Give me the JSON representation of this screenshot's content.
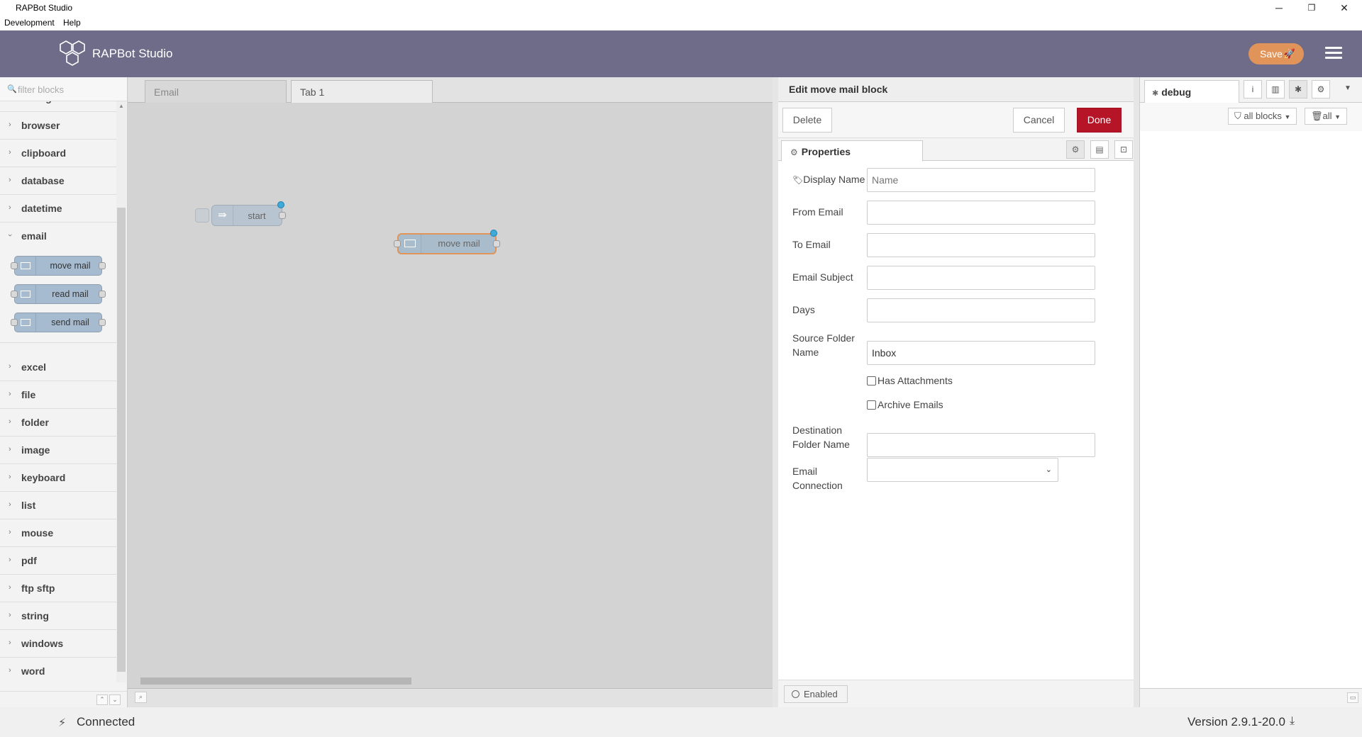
{
  "window": {
    "title": "RAPBot Studio",
    "minimize": "─",
    "restore": "❐",
    "close": "✕"
  },
  "menu": {
    "items": [
      "Development",
      "Help"
    ]
  },
  "header": {
    "app_name": "RAPBot Studio",
    "save_label": "Save",
    "accent": "#e0945a",
    "bg": "#6e6c88"
  },
  "palette": {
    "search_placeholder": "filter blocks",
    "categories_top": [
      "storage",
      "browser",
      "clipboard",
      "database",
      "datetime",
      "email"
    ],
    "email_nodes": [
      "move mail",
      "read mail",
      "send mail"
    ],
    "categories_bottom": [
      "excel",
      "file",
      "folder",
      "image",
      "keyboard",
      "list",
      "mouse",
      "pdf",
      "ftp sftp",
      "string",
      "windows",
      "word"
    ]
  },
  "workspace": {
    "tabs": [
      "Email",
      "Tab 1"
    ],
    "active_tab": "Tab 1",
    "nodes": {
      "start": "start",
      "move_mail": "move mail"
    }
  },
  "editor": {
    "title": "Edit move mail block",
    "delete_label": "Delete",
    "cancel_label": "Cancel",
    "done_label": "Done",
    "properties_tab": "Properties",
    "fields": {
      "display_name": {
        "label": "Display Name",
        "placeholder": "Name",
        "value": ""
      },
      "from_email": {
        "label": "From Email",
        "value": ""
      },
      "to_email": {
        "label": "To Email",
        "value": ""
      },
      "email_subject": {
        "label": "Email Subject",
        "value": ""
      },
      "days": {
        "label": "Days",
        "value": ""
      },
      "source_folder": {
        "label_line1": "Source Folder",
        "label_line2": "Name",
        "value": "Inbox"
      },
      "has_attachments": {
        "label": "Has Attachments",
        "checked": false
      },
      "archive_emails": {
        "label": "Archive Emails",
        "checked": false
      },
      "destination_folder": {
        "label_line1": "Destination",
        "label_line2": "Folder Name",
        "value": ""
      },
      "email_connection": {
        "label_line1": "Email",
        "label_line2": "Connection",
        "value": ""
      }
    },
    "enabled_label": "Enabled"
  },
  "sidebar": {
    "debug_tab": "debug",
    "filter_label": "all blocks",
    "clear_label": "all"
  },
  "status": {
    "connection": "Connected",
    "version": "Version 2.9.1-20.0"
  }
}
